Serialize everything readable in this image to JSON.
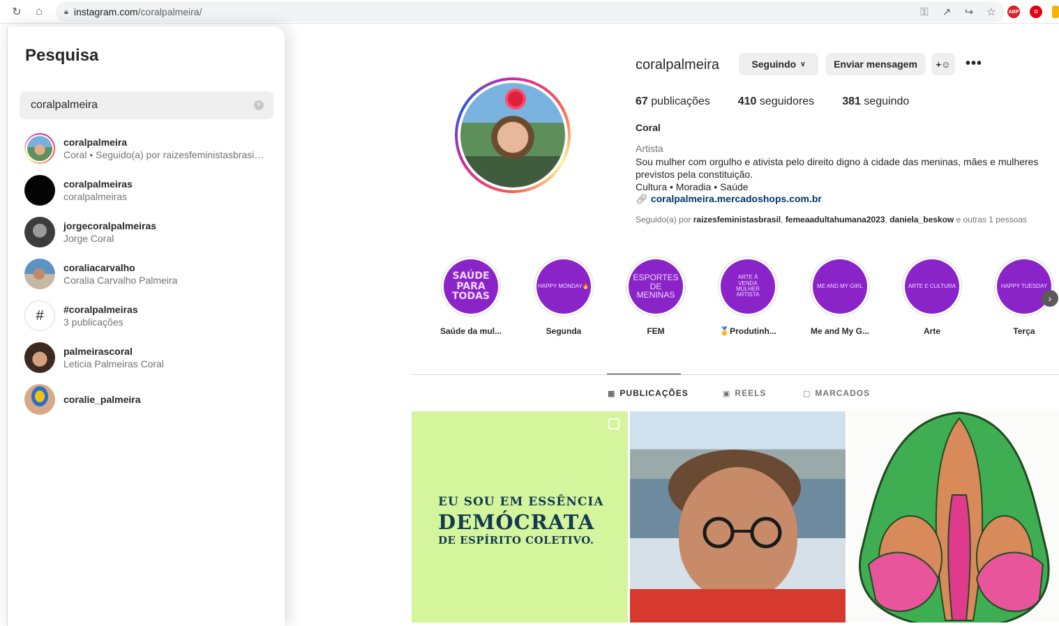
{
  "browser": {
    "url_host": "instagram.com",
    "url_path": "/coralpalmeira/",
    "ext_abp": "ABP"
  },
  "search": {
    "title": "Pesquisa",
    "query": "coralpalmeira",
    "clear_icon": "×",
    "results": [
      {
        "username": "coralpalmeira",
        "subtitle": "Coral • Seguido(a) por raizesfeministasbrasil ..."
      },
      {
        "username": "coralpalmeiras",
        "subtitle": "coralpalmeiras"
      },
      {
        "username": "jorgecoralpalmeiras",
        "subtitle": "Jorge Coral"
      },
      {
        "username": "coraliacarvalho",
        "subtitle": "Coralia Carvalho Palmeira"
      },
      {
        "username": "#coralpalmeiras",
        "subtitle": "3 publicações",
        "hash_symbol": "#"
      },
      {
        "username": "palmeirascoral",
        "subtitle": "Leticia Palmeiras Coral"
      },
      {
        "username": "coralie_palmeira",
        "subtitle": ""
      }
    ]
  },
  "profile": {
    "username": "coralpalmeira",
    "following_button": "Seguindo",
    "message_button": "Enviar mensagem",
    "more_icon": "•••",
    "stats": {
      "posts_count": "67",
      "posts_label": "publicações",
      "followers_count": "410",
      "followers_label": "seguidores",
      "following_count": "381",
      "following_label": "seguindo"
    },
    "full_name": "Coral",
    "category": "Artista",
    "bio_line1": "Sou mulher com orgulho e ativista pelo direito digno à cidade das meninas, mães e mulheres previstos pela constituição.",
    "bio_line2": "Cultura • Moradia • Saúde",
    "link": "coralpalmeira.mercadoshops.com.br",
    "followed_by_prefix": "Seguido(a) por",
    "followed_by_1": "raizesfeministasbrasil",
    "followed_by_2": "femeaadultahumana2023",
    "followed_by_3": "daniela_beskow",
    "followed_by_suffix": "e outras 1 pessoas"
  },
  "highlights": [
    {
      "cover": "SAÚDE PARA TODAS",
      "label": "Saúde da mul..."
    },
    {
      "cover": "HAPPY MONDAY🔥",
      "label": "Segunda"
    },
    {
      "cover": "ESPORTES DE MENINAS",
      "label": "FEM"
    },
    {
      "cover": "ARTE À VENDA MULHER ARTISTA",
      "label": "🥇Produtinh..."
    },
    {
      "cover": "ME AND MY GIRL",
      "label": "Me and My G..."
    },
    {
      "cover": "ARTE E CULTURA",
      "label": "Arte"
    },
    {
      "cover": "HAPPY TUESDAY",
      "label": "Terça"
    }
  ],
  "tabs": {
    "posts": "PUBLICAÇÕES",
    "reels": "REELS",
    "tagged": "MARCADOS"
  },
  "posts": {
    "post1_line1": "EU SOU EM ESSÊNCIA",
    "post1_line2": "DEMÓCRATA",
    "post1_line3": "DE ESPÍRITO COLETIVO."
  },
  "colors": {
    "highlight_purple": "#8a24c9",
    "link_blue": "#00376b",
    "post1_bg": "#d4f59c"
  }
}
